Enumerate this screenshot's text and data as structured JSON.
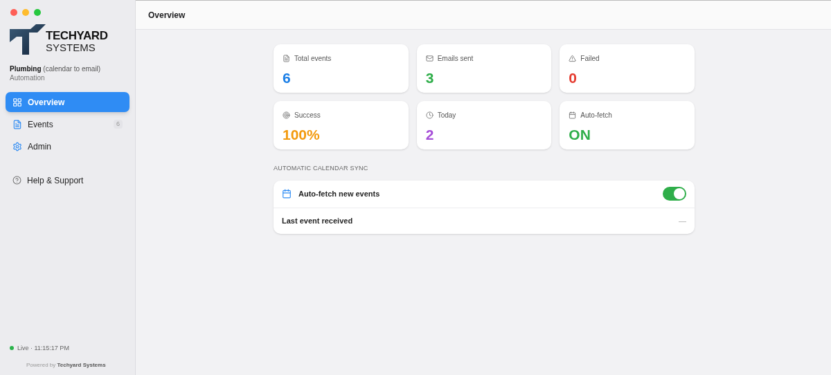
{
  "logo": {
    "line1": "TECHYARD",
    "line2": "SYSTEMS"
  },
  "workspace": {
    "name": "Plumbing",
    "detail": "(calendar to email)",
    "subtitle": "Automation"
  },
  "nav": [
    {
      "label": "Overview",
      "selected": true
    },
    {
      "label": "Events",
      "selected": false,
      "badge": "6"
    },
    {
      "label": "Admin",
      "selected": false
    }
  ],
  "help": {
    "label": "Help & Support"
  },
  "status": {
    "online": true,
    "text": "Live · 11:15:17 PM"
  },
  "footer": {
    "prefix": "Powered by",
    "brand": "Techyard Systems"
  },
  "header": {
    "title": "Overview"
  },
  "stats": [
    {
      "label": "Total events",
      "value": "6",
      "color": "#1a7ee6"
    },
    {
      "label": "Emails sent",
      "value": "3",
      "color": "#2fae4a"
    },
    {
      "label": "Failed",
      "value": "0",
      "color": "#e53b2f"
    },
    {
      "label": "Success",
      "value": "100%",
      "color": "#f39a0e"
    },
    {
      "label": "Today",
      "value": "2",
      "color": "#a64fd8"
    },
    {
      "label": "Auto-fetch",
      "value": "ON",
      "color": "#2fae4a"
    }
  ],
  "sync": {
    "heading": "AUTOMATIC CALENDAR SYNC",
    "toggle_label": "Auto-fetch new events",
    "on": true,
    "last_label": "Last event received",
    "last_value": "—"
  }
}
